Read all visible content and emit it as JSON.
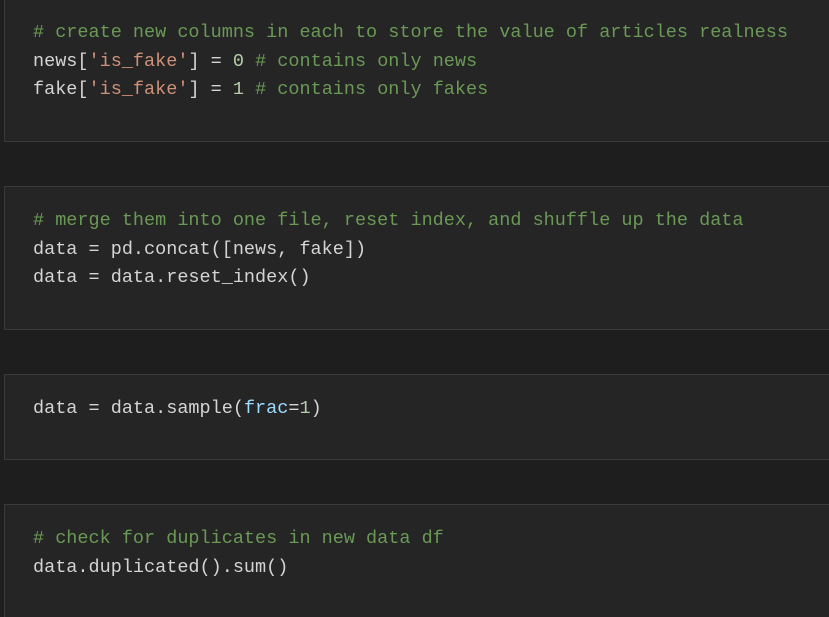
{
  "colors": {
    "background": "#1e1e1e",
    "cell_background": "#252526",
    "comment": "#6a9955",
    "string": "#ce9178",
    "number": "#b5cea8",
    "parameter": "#9cdcfe",
    "text": "#d4d4d4"
  },
  "cells": [
    {
      "lines": [
        {
          "comment": "# create new columns in each to store the value of articles realness"
        },
        {
          "t1": "news[",
          "str": "'is_fake'",
          "t2": "] = ",
          "num": "0",
          "t3": " ",
          "comment": "# contains only news"
        },
        {
          "t1": "fake[",
          "str": "'is_fake'",
          "t2": "] = ",
          "num": "1",
          "t3": " ",
          "comment": "# contains only fakes"
        }
      ]
    },
    {
      "lines": [
        {
          "comment": "# merge them into one file, reset index, and shuffle up the data"
        },
        {
          "code": "data = pd.concat([news, fake])"
        },
        {
          "code": "data = data.reset_index()"
        }
      ]
    },
    {
      "lines": [
        {
          "t1": "data = data.sample(",
          "param": "frac",
          "t2": "=",
          "num": "1",
          "t3": ")"
        }
      ]
    },
    {
      "lines": [
        {
          "comment": "# check for duplicates in new data df"
        },
        {
          "code": "data.duplicated().sum()"
        }
      ]
    }
  ]
}
